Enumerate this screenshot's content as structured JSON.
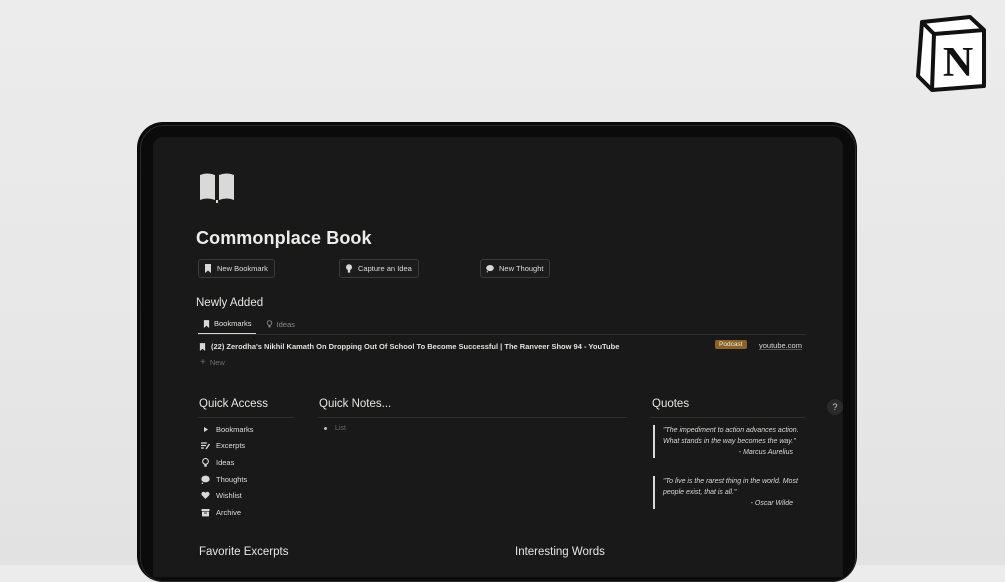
{
  "brand": {
    "logo_letter": "N"
  },
  "page": {
    "title": "Commonplace Book",
    "icon": "open-book-icon"
  },
  "buttons": [
    {
      "label": "New Bookmark",
      "icon": "bookmark-icon"
    },
    {
      "label": "Capture an Idea",
      "icon": "lightbulb-icon"
    },
    {
      "label": "New Thought",
      "icon": "thought-bubble-icon"
    }
  ],
  "newly_added": {
    "heading": "Newly Added",
    "tabs": [
      {
        "label": "Bookmarks",
        "icon": "bookmark-icon",
        "active": true
      },
      {
        "label": "Ideas",
        "icon": "lightbulb-icon",
        "active": false
      }
    ],
    "rows": [
      {
        "title": "(22) Zerodha's Nikhil Kamath On Dropping Out Of School To Become Successful | The Ranveer Show 94 - YouTube",
        "tag": "Podcast",
        "domain": "youtube.com"
      }
    ],
    "new_label": "New"
  },
  "quick_access": {
    "heading": "Quick Access",
    "items": [
      {
        "label": "Bookmarks",
        "icon": "triangle-right-icon"
      },
      {
        "label": "Excerpts",
        "icon": "edit-lines-icon"
      },
      {
        "label": "Ideas",
        "icon": "lightbulb-icon"
      },
      {
        "label": "Thoughts",
        "icon": "thought-bubble-icon"
      },
      {
        "label": "Wishlist",
        "icon": "heart-icon"
      },
      {
        "label": "Archive",
        "icon": "archive-box-icon"
      }
    ]
  },
  "quick_notes": {
    "heading": "Quick Notes...",
    "placeholder": "List"
  },
  "quotes": {
    "heading": "Quotes",
    "items": [
      {
        "text": "\"The impediment to action advances action. What stands in the way becomes the way.\"",
        "author": "- Marcus Aurelius"
      },
      {
        "text": "\"To live is the rarest thing in the world. Most people exist, that is all.\"",
        "author": "- Oscar Wilde"
      }
    ]
  },
  "bottom": {
    "favorite_excerpts": "Favorite Excerpts",
    "interesting_words": "Interesting Words"
  },
  "help": {
    "label": "?"
  },
  "colors": {
    "background": "#191919",
    "tag_podcast": "#89632a",
    "text": "#e8e8e6"
  }
}
